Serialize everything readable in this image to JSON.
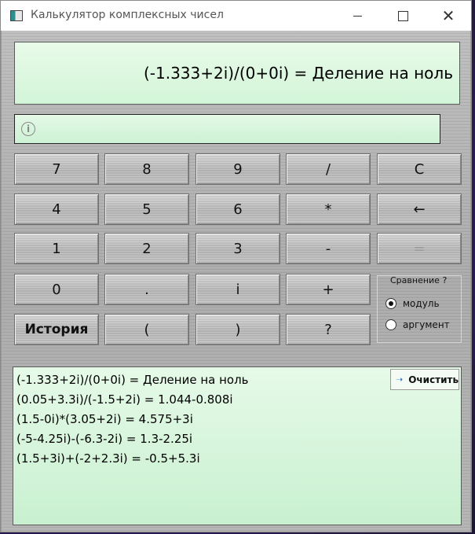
{
  "window": {
    "title": "Калькулятор комплексных чисел"
  },
  "display": {
    "text": "(-1.333+2i)/(0+0i) = Деление на ноль"
  },
  "info": {
    "text": ""
  },
  "keys": {
    "k7": "7",
    "k8": "8",
    "k9": "9",
    "div": "/",
    "clear": "C",
    "k4": "4",
    "k5": "5",
    "k6": "6",
    "mul": "*",
    "back": "←",
    "k1": "1",
    "k2": "2",
    "k3": "3",
    "minus": "-",
    "eq": "=",
    "k0": "0",
    "dot": ".",
    "i": "i",
    "plus": "+",
    "history": "История",
    "lparen": "(",
    "rparen": ")",
    "compare": "?"
  },
  "compare": {
    "title": "Сравнение ?",
    "options": [
      "модуль",
      "аргумент"
    ],
    "selected": "модуль"
  },
  "history": {
    "clear_label": "Очистить",
    "lines": [
      "(-1.333+2i)/(0+0i) = Деление на ноль",
      "(0.05+3.3i)/(-1.5+2i) = 1.044-0.808i",
      "(1.5-0i)*(3.05+2i) = 4.575+3i",
      "(-5-4.25i)-(-6.3-2i) = 1.3-2.25i",
      "(1.5+3i)+(-2+2.3i) = -0.5+5.3i"
    ]
  }
}
